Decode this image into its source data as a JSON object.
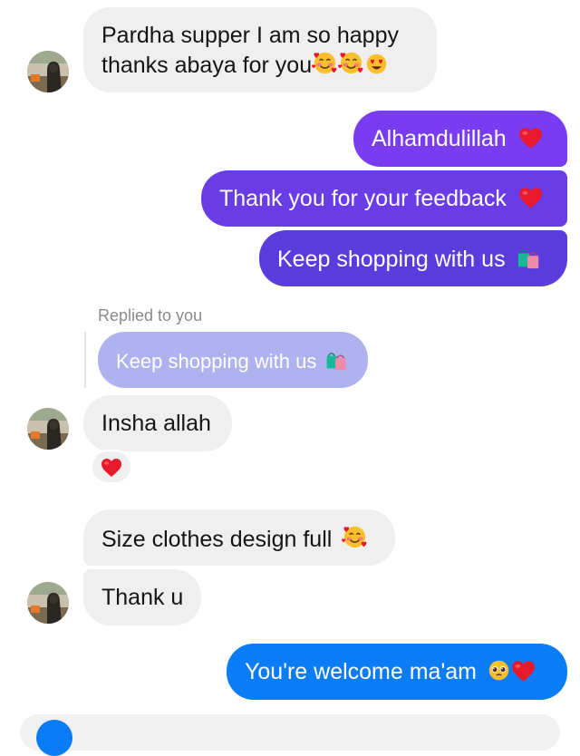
{
  "messages": {
    "m1_line1": "Pardha supper I am  so happy",
    "m1_line2": "thanks abaya for you",
    "m2": "Alhamdulillah",
    "m3": "Thank you for your feedback",
    "m4": "Keep shopping with us",
    "replied_label": "Replied to you",
    "quoted": "Keep shopping with us",
    "m5": "Insha allah",
    "m6": "Size clothes design full",
    "m7": "Thank u",
    "m8": "You're welcome ma'am"
  },
  "icons": [
    "smiling-face-with-hearts-icon",
    "heart-eyes-icon",
    "red-heart-icon",
    "shopping-bags-icon",
    "pleading-face-icon"
  ],
  "colors": {
    "incoming": "#efefef",
    "purple_top": "#7a3cf0",
    "purple_bottom": "#5a3bdc",
    "quoted": "#aeb2ef",
    "blue": "#0a7cf5"
  }
}
